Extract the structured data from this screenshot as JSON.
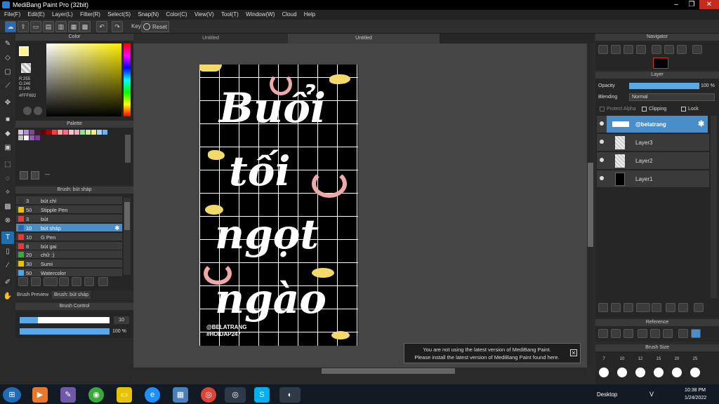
{
  "app": {
    "title": "MediBang Paint Pro (32bit)"
  },
  "menu": [
    "File(F)",
    "Edit(E)",
    "Layer(L)",
    "Filter(R)",
    "Select(S)",
    "Snap(N)",
    "Color(C)",
    "View(V)",
    "Tool(T)",
    "Window(W)",
    "Cloud",
    "Help"
  ],
  "toolbar": {
    "key_label": "Key",
    "reset_label": "Reset"
  },
  "tabs": [
    "Untitled",
    "Untitled"
  ],
  "color_panel": {
    "title": "Color",
    "r": "R:255",
    "g": "G:246",
    "b": "B:146",
    "hex": "#FFF692",
    "primary": "#FFF692",
    "secondary": "#FFFFFF"
  },
  "palette": {
    "title": "Palette",
    "dashes": "---",
    "colors": [
      "#d9c3e6",
      "#b58fcf",
      "#7a4b8f",
      "#3a1d2e",
      "#6b0000",
      "#b00000",
      "#ff3c3c",
      "#ffa6a6",
      "#ff6b8a",
      "#ffc0cb",
      "#f7a6c4",
      "#8ce68c",
      "#c8f0a0",
      "#ffe880",
      "#a0d8ff",
      "#6fb0ff",
      "#c0c0c0",
      "#ffffff",
      "#9b59b6",
      "#7b3fa0"
    ]
  },
  "brush": {
    "title": "Brush: bút sháp",
    "items": [
      {
        "size": "3",
        "name": "bút chì",
        "color": "#333333"
      },
      {
        "size": "50",
        "name": "Stipple Pen",
        "color": "#e6c200"
      },
      {
        "size": "3",
        "name": "bút",
        "color": "#e83a3a"
      },
      {
        "size": "10",
        "name": "bút sháp",
        "color": "#2a6ab3"
      },
      {
        "size": "10",
        "name": "G Pen",
        "color": "#e83a3a"
      },
      {
        "size": "8",
        "name": "bút gai",
        "color": "#e83a3a"
      },
      {
        "size": "20",
        "name": "chữ :)",
        "color": "#3aa83a"
      },
      {
        "size": "30",
        "name": "Sumi",
        "color": "#e6c200"
      },
      {
        "size": "50",
        "name": "Watercolor",
        "color": "#4aa8e6"
      }
    ]
  },
  "brush_tabs": {
    "preview": "Brush Preview",
    "current": "Brush: bút sháp"
  },
  "brush_control": {
    "title": "Brush Control",
    "size": "10",
    "opacity": "100 %",
    "size_fraction": 0.2,
    "opacity_fraction": 1.0
  },
  "canvas": {
    "text_lines": [
      "Buổi",
      "tối",
      "ngọt",
      "ngào"
    ],
    "watermark1": "@BELATRANG",
    "watermark2": "#HOIDAP247"
  },
  "notice": {
    "line1": "You are not using the latest version of MediBang Paint.",
    "line2": "Please install the latest version of MediBang Paint found here."
  },
  "navigator": {
    "title": "Navigator"
  },
  "layer_panel": {
    "title": "Layer",
    "opacity_label": "Opacity",
    "opacity_value": "100 %",
    "blending_label": "Blending",
    "blending_value": "Normal",
    "protect_alpha": "Protect Alpha",
    "clipping": "Clipping",
    "lock": "Lock",
    "layers": [
      {
        "name": "@belatrang"
      },
      {
        "name": "Layer3"
      },
      {
        "name": "Layer2"
      },
      {
        "name": "Layer1"
      }
    ]
  },
  "reference": {
    "title": "Reference"
  },
  "brush_size": {
    "title": "Brush Size",
    "values": [
      "7",
      "10",
      "12",
      "15",
      "20",
      "25"
    ]
  },
  "taskbar": {
    "desktop": "Desktop",
    "time": "10:38 PM",
    "date": "1/24/2022",
    "lang": "V"
  }
}
